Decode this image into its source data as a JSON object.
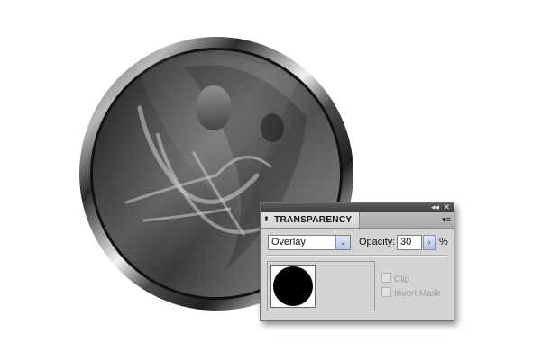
{
  "panel": {
    "title": "TRANSPARENCY",
    "blend_mode": "Overlay",
    "opacity_label": "Opacity:",
    "opacity_value": "30",
    "opacity_unit": "%",
    "clip_label": "Clip",
    "invert_mask_label": "Invert Mask",
    "clip_checked": false,
    "invert_mask_checked": false,
    "icons": {
      "collapse": "double-left-arrow-icon",
      "close": "close-icon",
      "tab_arrows": "up-down-arrows-icon",
      "menu": "panel-menu-icon",
      "dropdown": "chevron-down-icon",
      "stepper": "chevron-right-icon"
    },
    "glyphs": {
      "collapse": "◂◂",
      "close": "✕",
      "tab_arrows": "⬍",
      "menu": "▾≡",
      "dropdown": "⌄",
      "stepper": "›"
    }
  }
}
